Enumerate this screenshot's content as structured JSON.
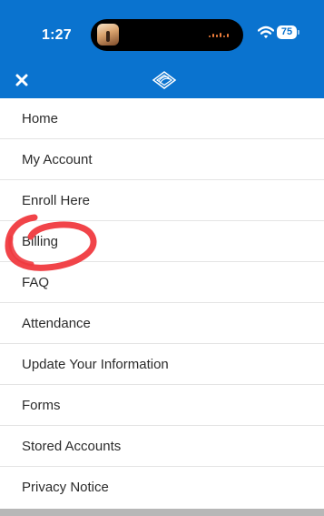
{
  "status_bar": {
    "time": "1:27",
    "battery": "75",
    "color": "#0a73cf"
  },
  "header": {
    "close_icon": "close-icon",
    "logo_icon": "logo-icon",
    "color": "#0a73cf"
  },
  "menu": {
    "items": [
      {
        "label": "Home"
      },
      {
        "label": "My Account"
      },
      {
        "label": "Enroll Here"
      },
      {
        "label": "Billing"
      },
      {
        "label": "FAQ"
      },
      {
        "label": "Attendance"
      },
      {
        "label": "Update Your Information"
      },
      {
        "label": "Forms"
      },
      {
        "label": "Stored Accounts"
      },
      {
        "label": "Privacy Notice"
      }
    ]
  },
  "annotation": {
    "color": "#f03a3f",
    "shape": "hand-drawn-circle"
  }
}
